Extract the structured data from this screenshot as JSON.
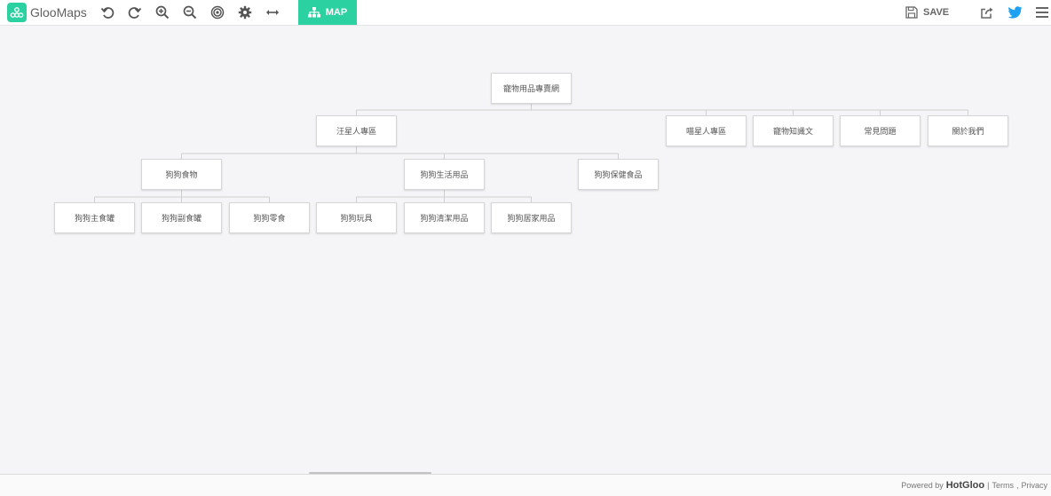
{
  "app": {
    "name": "GlooMaps",
    "accent": "#2bd1a0",
    "twitter_color": "#1da1f2"
  },
  "toolbar": {
    "map_label": "MAP",
    "save_label": "SAVE",
    "tools": [
      {
        "icon": "undo-icon"
      },
      {
        "icon": "redo-icon"
      },
      {
        "icon": "zoom-in-icon"
      },
      {
        "icon": "zoom-out-icon"
      },
      {
        "icon": "target-icon"
      },
      {
        "icon": "gear-icon"
      },
      {
        "icon": "expand-horizontal-icon"
      }
    ]
  },
  "sitemap": {
    "root": "寵物用品專賣網",
    "nodes": {
      "dog": "汪星人專區",
      "cat": "喵星人專區",
      "knowledge": "寵物知識文",
      "faq": "常見問題",
      "about": "關於我們",
      "dog_food": "狗狗食物",
      "dog_life": "狗狗生活用品",
      "dog_health": "狗狗保健食品",
      "dog_main_can": "狗狗主食罐",
      "dog_side_can": "狗狗副食罐",
      "dog_snack": "狗狗零食",
      "dog_toy": "狗狗玩具",
      "dog_clean": "狗狗清潔用品",
      "dog_home": "狗狗居家用品"
    }
  },
  "footer": {
    "powered_by": "Powered by",
    "brand": "HotGloo",
    "sep1": "|",
    "terms": "Terms",
    "sep2": ",",
    "privacy": "Privacy"
  }
}
